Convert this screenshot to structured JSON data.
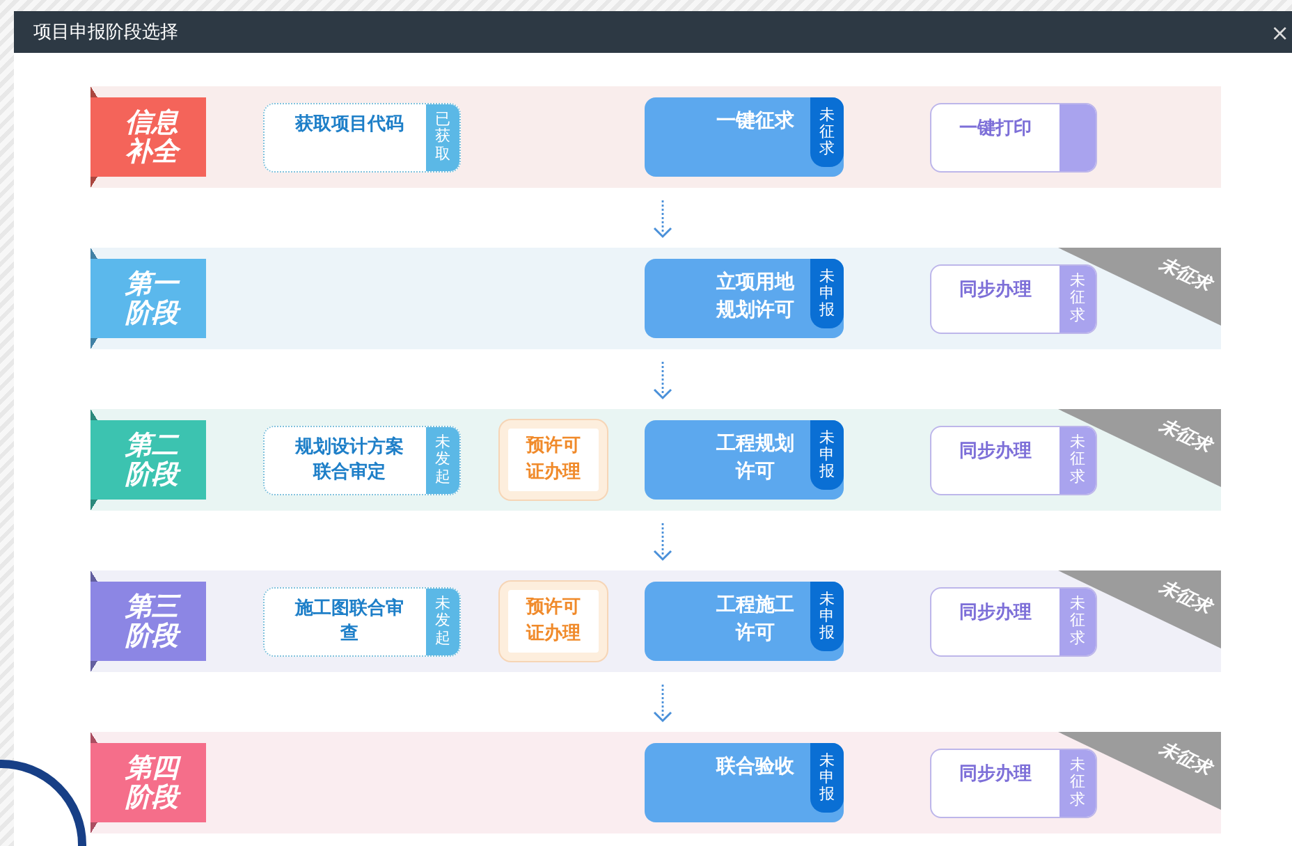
{
  "window": {
    "title": "项目申报阶段选择",
    "close": "×"
  },
  "stages": [
    {
      "label": "信息补全",
      "color": "#f4645a",
      "review": {
        "text": "获取项目代码",
        "status": "已获取"
      },
      "main": {
        "text": "一键征求",
        "status": "未征求"
      },
      "side": {
        "text": "一键打印"
      }
    },
    {
      "label": "第一阶段",
      "color": "#5bb8ec",
      "main": {
        "text": "立项用地规划许可",
        "status": "未申报"
      },
      "side": {
        "text": "同步办理",
        "status": "未征求"
      },
      "ribbon": "未征求"
    },
    {
      "label": "第二阶段",
      "color": "#3cc3b0",
      "review": {
        "text": "规划设计方案联合审定",
        "status": "未发起"
      },
      "permit": "预许可证办理",
      "main": {
        "text": "工程规划许可",
        "status": "未申报"
      },
      "side": {
        "text": "同步办理",
        "status": "未征求"
      },
      "ribbon": "未征求"
    },
    {
      "label": "第三阶段",
      "color": "#8c86e4",
      "review": {
        "text": "施工图联合审查",
        "status": "未发起"
      },
      "permit": "预许可证办理",
      "main": {
        "text": "工程施工许可",
        "status": "未申报"
      },
      "side": {
        "text": "同步办理",
        "status": "未征求"
      },
      "ribbon": "未征求"
    },
    {
      "label": "第四阶段",
      "color": "#f56e8a",
      "main": {
        "text": "联合验收",
        "status": "未申报"
      },
      "side": {
        "text": "同步办理",
        "status": "未征求"
      },
      "ribbon": "未征求"
    }
  ]
}
